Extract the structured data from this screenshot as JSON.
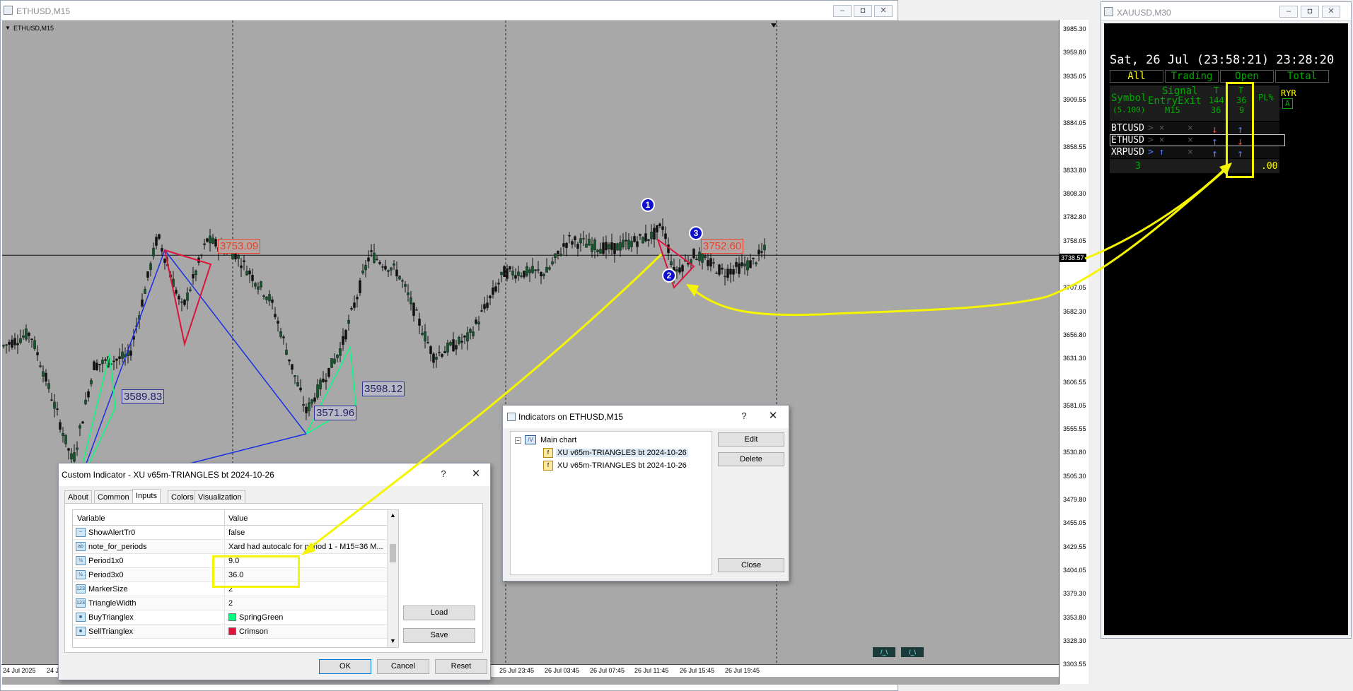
{
  "chart_window": {
    "title": "ETHUSD,M15",
    "label": "ETHUSD,M15",
    "price_axis": [
      "3985.30",
      "3959.80",
      "3935.05",
      "3909.55",
      "3884.05",
      "3858.55",
      "3833.80",
      "3808.30",
      "3782.80",
      "3758.05",
      "3738.57",
      "3707.05",
      "3682.30",
      "3656.80",
      "3631.30",
      "3606.55",
      "3581.05",
      "3555.55",
      "3530.80",
      "3505.30",
      "3479.80",
      "3455.05",
      "3429.55",
      "3404.05",
      "3379.30",
      "3353.80",
      "3328.30",
      "3303.55"
    ],
    "time_axis": [
      "24 Jul 2025",
      "24 J",
      "25 Jul 23:45",
      "26 Jul 03:45",
      "26 Jul 07:45",
      "26 Jul 11:45",
      "26 Jul 15:45",
      "26 Jul 19:45"
    ],
    "price_labels": {
      "p1": "3753.09",
      "p2": "3589.83",
      "p3": "3571.96",
      "p4": "3598.12",
      "p5": "3752.60"
    },
    "markers": [
      "1",
      "2",
      "3"
    ],
    "bottom_tags": [
      "/_\\",
      "/_\\"
    ],
    "colors": {
      "bg": "#a8a8a8",
      "candle_up": "#1a1a1a",
      "buy_triangle": "#00ff7f",
      "sell_triangle": "#dc143c",
      "blue_line": "#1a2ee6",
      "highlight": "#f5f500"
    }
  },
  "dash_window": {
    "title": "XAUUSD,M30",
    "datetime": "Sat, 26 Jul (23:58:21) 23:28:20",
    "tabs": [
      "All",
      "Trading",
      "Open",
      "Total"
    ],
    "headers": {
      "symbol": "Symbol",
      "symbol2": "(5.100)",
      "signal": "Signal",
      "signal2": "EntryExit",
      "signal3": "M15",
      "t1": "T",
      "t1b": "144",
      "t1c": "36",
      "t2": "T",
      "t2b": "36",
      "t2c": "9",
      "pl": "PL%",
      "ryr": "RYR",
      "ryr2": "A"
    },
    "rows": [
      {
        "symbol": "BTCUSD",
        "sig": "> ×",
        "x": "×",
        "a1": "↓",
        "a2": "↑"
      },
      {
        "symbol": "ETHUSD",
        "sig": "> ×",
        "x": "×",
        "a1": "↑",
        "a2": "↓"
      },
      {
        "symbol": "XRPUSD",
        "sig": "> ↑",
        "x": "×",
        "a1": "↑",
        "a2": "↑"
      }
    ],
    "footer_count": "3",
    "footer_value": ".00"
  },
  "indicator_dialog": {
    "title": "Custom Indicator - XU v65m-TRIANGLES bt 2024-10-26",
    "help": "?",
    "tabs": [
      "About",
      "Common",
      "Inputs",
      "Colors",
      "Visualization"
    ],
    "col_variable": "Variable",
    "col_value": "Value",
    "rows": [
      {
        "icon": "~",
        "name": "ShowAlertTr0",
        "value": "false"
      },
      {
        "icon": "ab",
        "name": "note_for_periods",
        "value": "Xard had autocalc for period 1 - M15=36 M..."
      },
      {
        "icon": "½",
        "name": "Period1x0",
        "value": "9.0"
      },
      {
        "icon": "½",
        "name": "Period3x0",
        "value": "36.0"
      },
      {
        "icon": "123",
        "name": "MarkerSize",
        "value": "2"
      },
      {
        "icon": "123",
        "name": "TriangleWidth",
        "value": "2"
      },
      {
        "icon": "■",
        "name": "BuyTrianglex",
        "value": "SpringGreen",
        "swatch": "#00ff7f"
      },
      {
        "icon": "■",
        "name": "SellTrianglex",
        "value": "Crimson",
        "swatch": "#dc143c"
      }
    ],
    "load": "Load",
    "save": "Save",
    "ok": "OK",
    "cancel": "Cancel",
    "reset": "Reset"
  },
  "indicators_dialog": {
    "title": "Indicators on ETHUSD,M15",
    "help": "?",
    "root": "Main chart",
    "items": [
      "XU v65m-TRIANGLES bt 2024-10-26",
      "XU v65m-TRIANGLES bt 2024-10-26"
    ],
    "edit": "Edit",
    "delete": "Delete",
    "close": "Close"
  }
}
